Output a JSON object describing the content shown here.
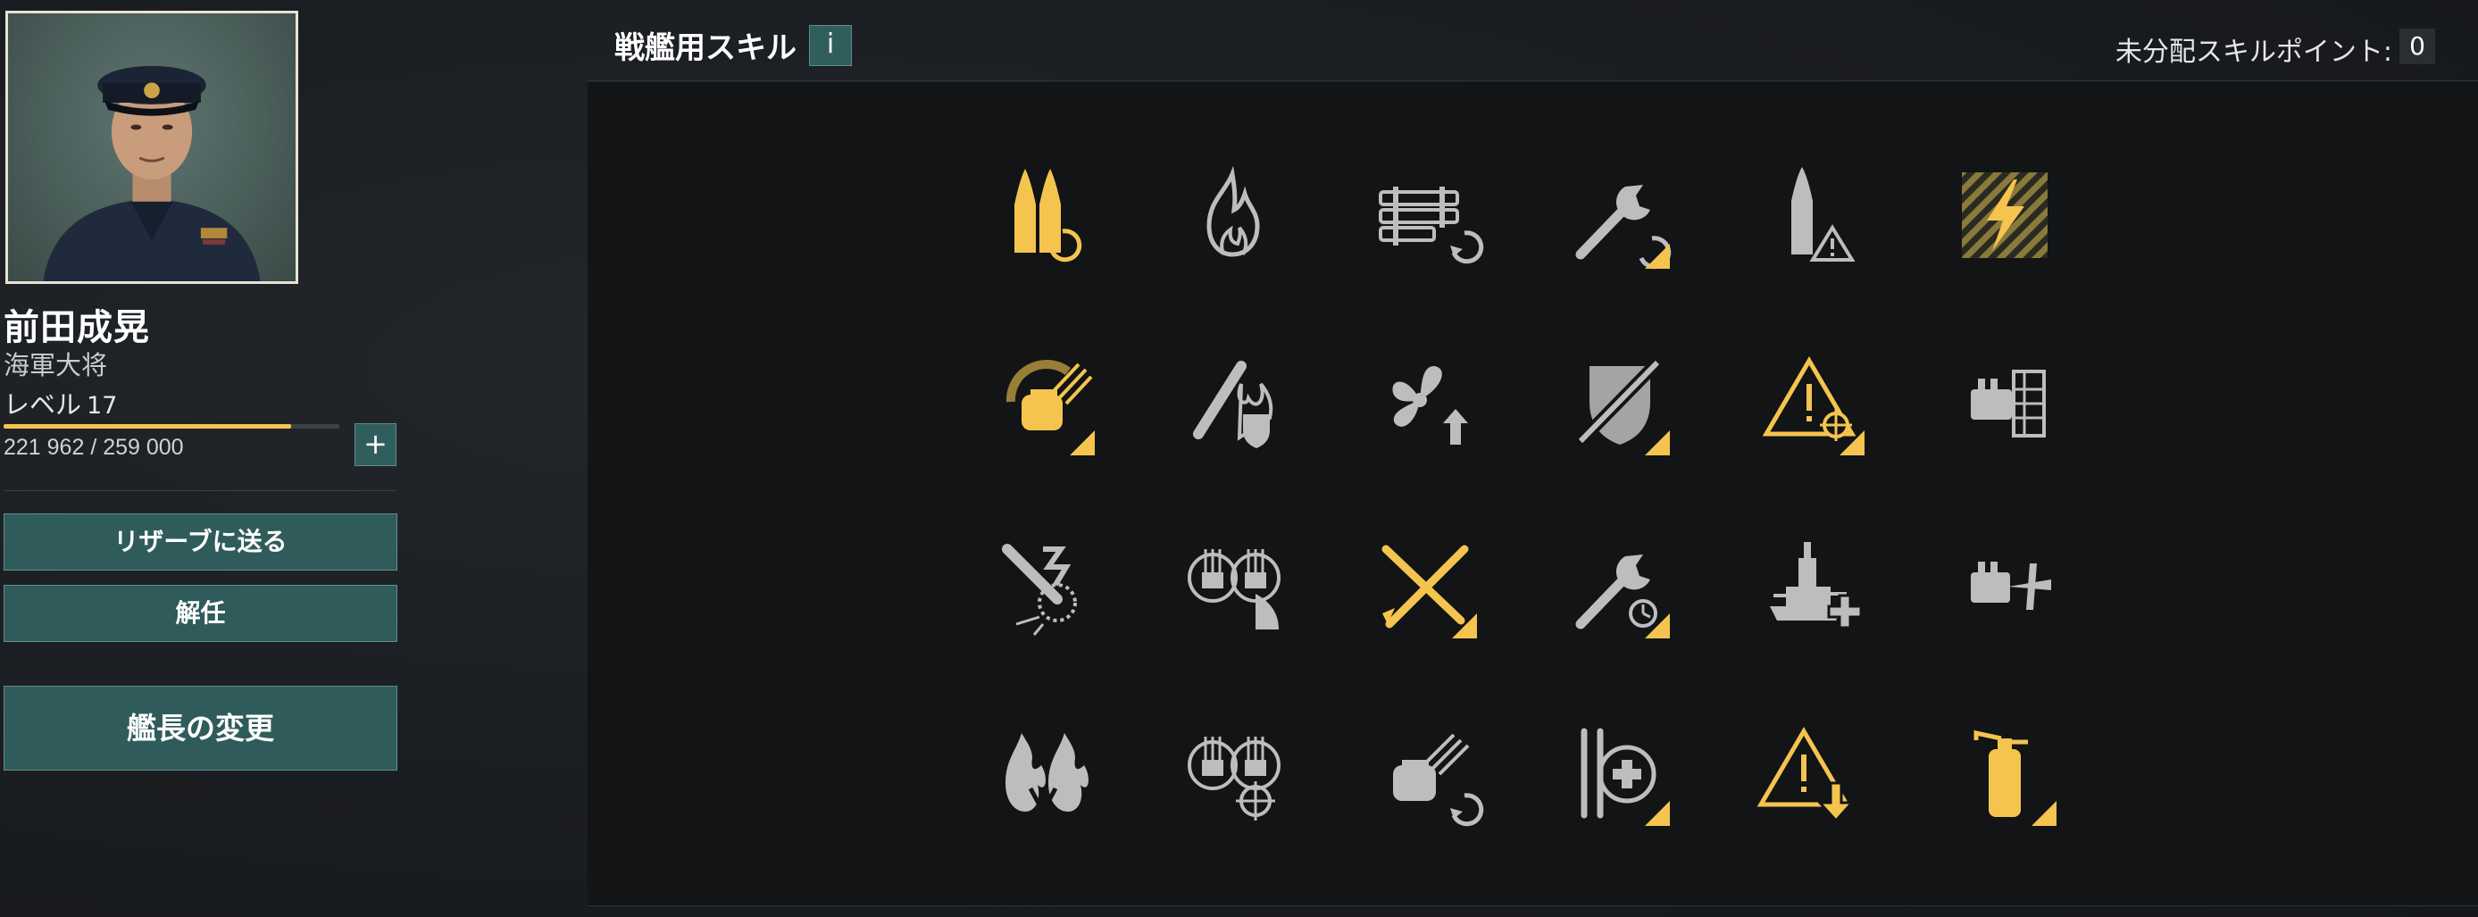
{
  "commander": {
    "name": "前田成晃",
    "rank": "海軍大将",
    "level_label": "レベル",
    "level": "17",
    "xp_text": "221 962 / 259 000",
    "xp_progress": 0.857
  },
  "buttons": {
    "plus": "+",
    "reserve": "リザーブに送る",
    "dismiss": "解任",
    "change": "艦長の変更"
  },
  "skills_panel": {
    "title": "戦艦用スキル",
    "info": "i",
    "points_label": "未分配スキルポイント:",
    "points_value": "0"
  },
  "colors": {
    "accent_yellow": "#f4c44e",
    "icon_gray": "#bdbdbd",
    "button_teal": "#2f5c5a"
  },
  "skills": [
    [
      {
        "icon": "double-shell-reload-icon",
        "state": "learned"
      },
      {
        "icon": "fire-icon",
        "state": "available"
      },
      {
        "icon": "torpedo-reload-icon",
        "state": "available"
      },
      {
        "icon": "wrench-repair-icon",
        "state": "available-upgrade"
      },
      {
        "icon": "shell-warning-icon",
        "state": "available"
      },
      {
        "icon": "lightning-hazard-icon",
        "state": "learned"
      }
    ],
    [
      {
        "icon": "turret-traverse-icon",
        "state": "learned-upgrade"
      },
      {
        "icon": "fire-resistance-icon",
        "state": "available"
      },
      {
        "icon": "propeller-boost-icon",
        "state": "available"
      },
      {
        "icon": "armor-shield-icon",
        "state": "available-upgrade"
      },
      {
        "icon": "warning-target-icon",
        "state": "learned-upgrade"
      },
      {
        "icon": "secondary-battery-icon",
        "state": "available"
      }
    ],
    [
      {
        "icon": "aa-burst-icon",
        "state": "available"
      },
      {
        "icon": "aa-gun-range-icon",
        "state": "available"
      },
      {
        "icon": "crossed-torpedoes-icon",
        "state": "learned-upgrade"
      },
      {
        "icon": "wrench-timer-icon",
        "state": "available-upgrade"
      },
      {
        "icon": "battleship-heal-icon",
        "state": "available"
      },
      {
        "icon": "secondary-aircraft-icon",
        "state": "available"
      }
    ],
    [
      {
        "icon": "double-fire-icon",
        "state": "available"
      },
      {
        "icon": "gun-crosshair-icon",
        "state": "available"
      },
      {
        "icon": "turret-reload-icon",
        "state": "available"
      },
      {
        "icon": "repair-heal-icon",
        "state": "available-upgrade"
      },
      {
        "icon": "warning-down-icon",
        "state": "learned"
      },
      {
        "icon": "fire-extinguisher-icon",
        "state": "learned-upgrade"
      }
    ]
  ]
}
